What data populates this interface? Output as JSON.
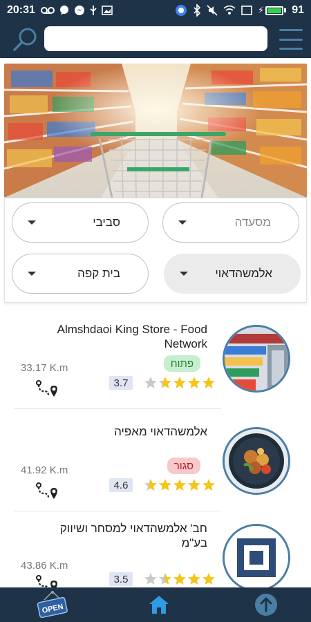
{
  "status_bar": {
    "time": "20:31",
    "battery": "91",
    "battery_level": 0.91
  },
  "header": {
    "search_placeholder": "",
    "search_value": ""
  },
  "filters": {
    "restaurant": "מסעדה",
    "area": "סביבי",
    "store": "אלמשהדאוי",
    "cafe": "בית קפה"
  },
  "stores": [
    {
      "name": "Almshdaoi King Store - Food Network",
      "status": "פתוח",
      "status_type": "open",
      "rating": "3.7",
      "stars": 3.7,
      "distance": "33.17 K.m"
    },
    {
      "name": "אלמשהדאוי מאפיה",
      "status": "סגור",
      "status_type": "closed",
      "rating": "4.6",
      "stars": 4.6,
      "distance": "41.92 K.m"
    },
    {
      "name": "חב' אלמשהדאוי למסחר ושיווק בע\"מ",
      "status": "",
      "status_type": "",
      "rating": "3.5",
      "stars": 3.5,
      "distance": "43.86 K.m"
    }
  ],
  "bottom_nav": {
    "open_sign": "OPEN"
  },
  "colors": {
    "primary": "#1e3347",
    "accent": "#4b7ea4",
    "star": "#f5c518",
    "open_badge": "#c6efcf",
    "closed_badge": "#f6c9cc"
  }
}
